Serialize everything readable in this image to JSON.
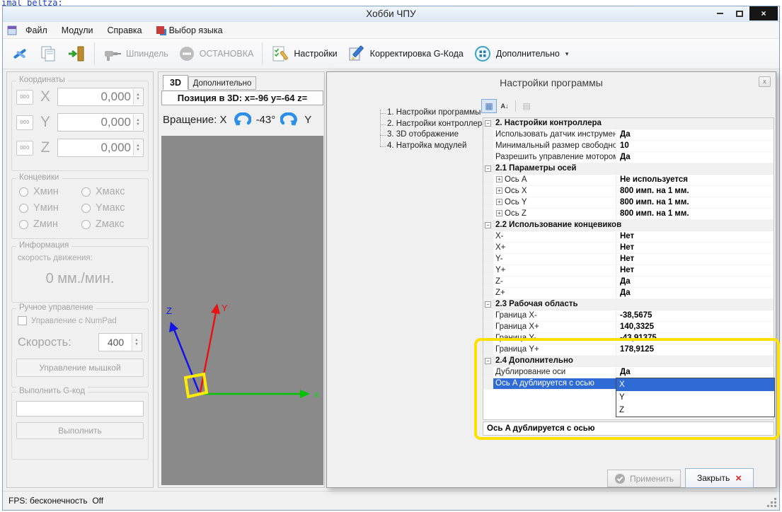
{
  "artifact": {
    "text": "imal beltza;"
  },
  "icons": {
    "close": "×",
    "dialog_close": "x",
    "close_red": "×",
    "collapse": "−",
    "expand": "+",
    "spinner_up": "▲",
    "spinner_down": "▼",
    "more_caret": "▾",
    "categorized": "▦",
    "alphabetical": "A↓",
    "property_pages": "▤"
  },
  "window": {
    "title": "Хобби ЧПУ"
  },
  "menu": {
    "items": [
      {
        "id": "file",
        "label": "Файл"
      },
      {
        "id": "modules",
        "label": "Модули"
      },
      {
        "id": "help",
        "label": "Справка"
      },
      {
        "id": "language",
        "label": "Выбор языка",
        "icon": "language-icon"
      }
    ]
  },
  "toolbar": {
    "spindle": "Шпиндель",
    "stop": "ОСТАНОВКА",
    "settings": "Настройки",
    "gcode_fix": "Корректировка G-Кода",
    "more": "Дополнительно"
  },
  "left_panel": {
    "coordinates": {
      "title": "Координаты",
      "axes": [
        {
          "axis": "X",
          "reset": "000",
          "value": "0,000"
        },
        {
          "axis": "Y",
          "reset": "000",
          "value": "0,000"
        },
        {
          "axis": "Z",
          "reset": "000",
          "value": "0,000"
        }
      ]
    },
    "limits": {
      "title": "Концевики",
      "items": [
        {
          "id": "x-min",
          "label": "Хмин"
        },
        {
          "id": "x-max",
          "label": "Хмакс"
        },
        {
          "id": "y-min",
          "label": "Yмин"
        },
        {
          "id": "y-max",
          "label": "Yмакс"
        },
        {
          "id": "z-min",
          "label": "Zмин"
        },
        {
          "id": "z-max",
          "label": "Zмакс"
        }
      ]
    },
    "info": {
      "title": "Информация",
      "speed_label": "скорость движения:",
      "speed_value": "0 мм./мин."
    },
    "manual": {
      "title": "Ручное управление",
      "numpad": "Управление с NumPad",
      "speed_label": "Скорость:",
      "speed_value": "400",
      "mouse_button": "Управление мышкой"
    },
    "gcode": {
      "title": "Выполнить G-код",
      "input_value": "",
      "run_button": "Выполнить"
    }
  },
  "viewport": {
    "tabs": [
      {
        "id": "3d",
        "label": "3D"
      },
      {
        "id": "additional",
        "label": "Дополнительно"
      }
    ],
    "position": "Позиция в 3D: x=-96 y=-64 z=",
    "rotation": {
      "prefix": "Вращение: X",
      "value": "-43°",
      "suffix": "Y"
    },
    "axis_labels": {
      "x": "x",
      "y": "Y",
      "z": "Z"
    }
  },
  "dialog": {
    "title": "Настройки программы",
    "tree": [
      {
        "id": "program",
        "label": "1. Настройки программы"
      },
      {
        "id": "controller",
        "label": "2. Настройки контроллера"
      },
      {
        "id": "display-3d",
        "label": "3. 3D отображение"
      },
      {
        "id": "modules",
        "label": "4. Натройка модулей"
      }
    ],
    "grid": {
      "rows": [
        {
          "type": "category",
          "label": "2. Настройки контроллера"
        },
        {
          "type": "prop",
          "label": "Использовать датчик инструмент",
          "value": "Да"
        },
        {
          "type": "prop",
          "label": "Минимальный размер свободног",
          "value": "10"
        },
        {
          "type": "prop",
          "label": "Разрешить управление мотором",
          "value": "Да"
        },
        {
          "type": "category",
          "label": "2.1 Параметры осей"
        },
        {
          "type": "prop",
          "expand": true,
          "label": "Ось A",
          "value": "Не используется"
        },
        {
          "type": "prop",
          "expand": true,
          "label": "Ось X",
          "value": "800 имп. на 1 мм."
        },
        {
          "type": "prop",
          "expand": true,
          "label": "Ось Y",
          "value": "800 имп. на 1 мм."
        },
        {
          "type": "prop",
          "expand": true,
          "label": "Ось Z",
          "value": "800 имп. на 1 мм."
        },
        {
          "type": "category",
          "label": "2.2 Использование концевиков"
        },
        {
          "type": "prop",
          "label": "X-",
          "value": "Нет"
        },
        {
          "type": "prop",
          "label": "X+",
          "value": "Нет"
        },
        {
          "type": "prop",
          "label": "Y-",
          "value": "Нет"
        },
        {
          "type": "prop",
          "label": "Y+",
          "value": "Нет"
        },
        {
          "type": "prop",
          "label": "Z-",
          "value": "Да"
        },
        {
          "type": "prop",
          "label": "Z+",
          "value": "Да"
        },
        {
          "type": "category",
          "label": "2.3 Рабочая область"
        },
        {
          "type": "prop",
          "label": "Граница X-",
          "value": "-38,5675"
        },
        {
          "type": "prop",
          "label": "Граница X+",
          "value": "140,3325"
        },
        {
          "type": "prop",
          "label": "Граница Y-",
          "value": "-43,91375"
        },
        {
          "type": "prop",
          "label": "Граница Y+",
          "value": "178,9125"
        },
        {
          "type": "category",
          "label": "2.4 Дополнительно"
        },
        {
          "type": "prop",
          "label": "Дублирование оси",
          "value": "Да"
        },
        {
          "type": "prop",
          "selected": true,
          "combo": true,
          "label": "Ось A дублируется с осью",
          "value": "X"
        }
      ],
      "dropdown": {
        "options": [
          "X",
          "Y",
          "Z"
        ],
        "selected": "X"
      },
      "description": "Ось A дублируется с осью"
    },
    "buttons": {
      "apply": "Применить",
      "close": "Закрыть"
    }
  },
  "statusbar": {
    "text": "FPS: бесконечность  Off"
  }
}
